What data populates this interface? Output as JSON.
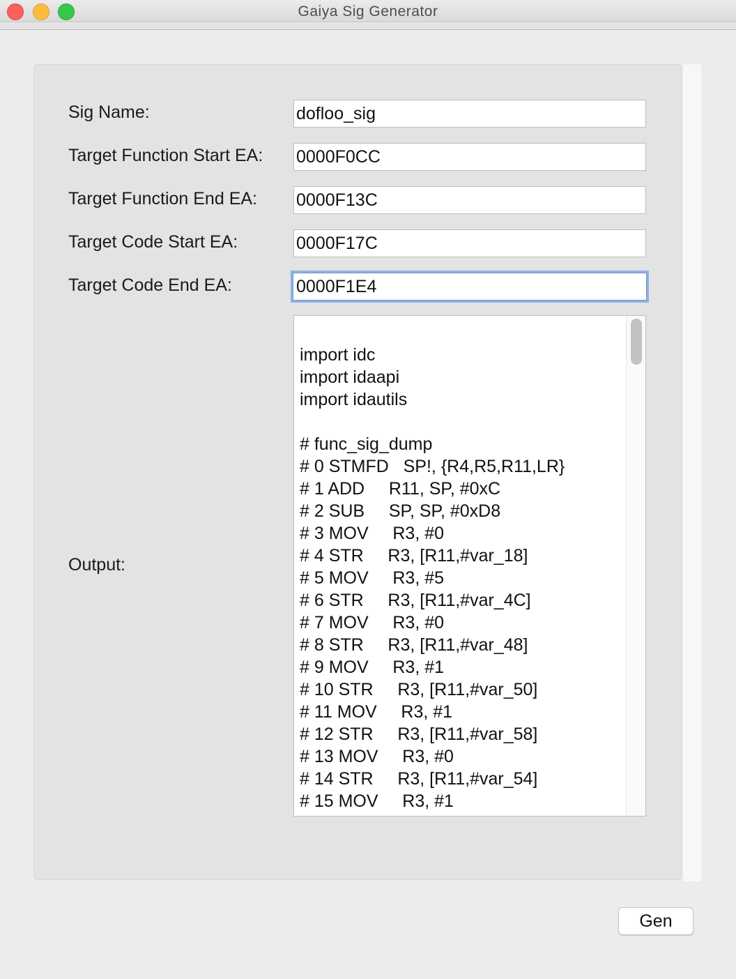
{
  "window": {
    "title": "Gaiya Sig Generator"
  },
  "form": {
    "sig_name": {
      "label": "Sig Name:",
      "value": "dofloo_sig"
    },
    "func_start": {
      "label": "Target Function Start EA:",
      "value": "0000F0CC"
    },
    "func_end": {
      "label": "Target Function End EA:",
      "value": "0000F13C"
    },
    "code_start": {
      "label": "Target Code Start EA:",
      "value": "0000F17C"
    },
    "code_end": {
      "label": "Target Code End EA:",
      "value": "0000F1E4"
    },
    "output": {
      "label": "Output:",
      "lines": [
        "import idc",
        "import idaapi",
        "import idautils",
        "",
        "# func_sig_dump",
        "# 0 STMFD   SP!, {R4,R5,R11,LR}",
        "# 1 ADD     R11, SP, #0xC",
        "# 2 SUB     SP, SP, #0xD8",
        "# 3 MOV     R3, #0",
        "# 4 STR     R3, [R11,#var_18]",
        "# 5 MOV     R3, #5",
        "# 6 STR     R3, [R11,#var_4C]",
        "# 7 MOV     R3, #0",
        "# 8 STR     R3, [R11,#var_48]",
        "# 9 MOV     R3, #1",
        "# 10 STR     R3, [R11,#var_50]",
        "# 11 MOV     R3, #1",
        "# 12 STR     R3, [R11,#var_58]",
        "# 13 MOV     R3, #0",
        "# 14 STR     R3, [R11,#var_54]",
        "# 15 MOV     R3, #1"
      ]
    }
  },
  "buttons": {
    "gen_label": "Gen"
  },
  "colors": {
    "focus_ring": "#8fb2e3",
    "close": "#fc605b",
    "minimize": "#fdbc40",
    "maximize": "#34c84a"
  }
}
